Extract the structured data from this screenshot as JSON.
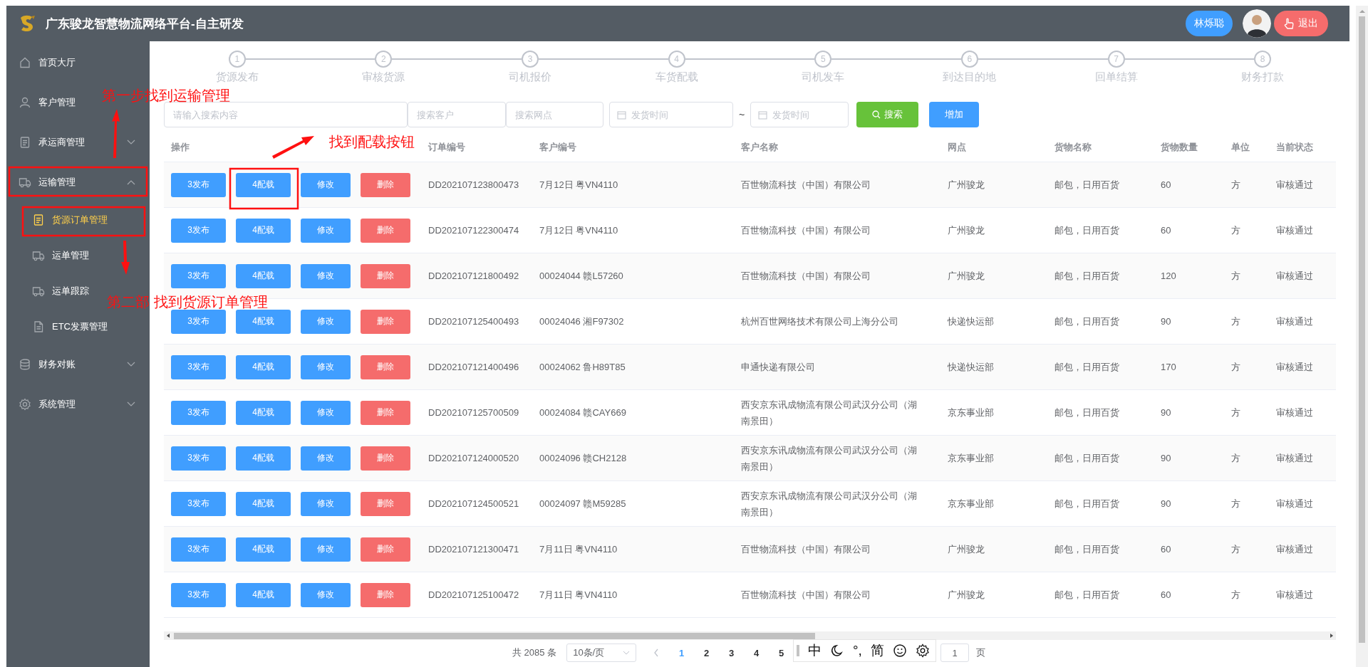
{
  "header": {
    "title": "广东骏龙智慧物流网络平台-自主研发",
    "user_name": "林烁聪",
    "logout": "退出"
  },
  "sidebar": {
    "items": [
      {
        "label": "首页大厅",
        "selected": false
      },
      {
        "label": "客户管理",
        "selected": false
      },
      {
        "label": "承运商管理",
        "selected": false,
        "expanded": false
      },
      {
        "label": "运输管理",
        "selected": false,
        "expanded": true,
        "children": [
          {
            "label": "货源订单管理",
            "selected": true
          },
          {
            "label": "运单管理",
            "selected": false
          },
          {
            "label": "运单跟踪",
            "selected": false
          },
          {
            "label": "ETC发票管理",
            "selected": false
          }
        ]
      },
      {
        "label": "财务对账",
        "selected": false,
        "expanded": false
      },
      {
        "label": "系统管理",
        "selected": false,
        "expanded": false
      }
    ]
  },
  "steps": [
    {
      "number": "1",
      "label": "货源发布"
    },
    {
      "number": "2",
      "label": "审核货源"
    },
    {
      "number": "3",
      "label": "司机报价"
    },
    {
      "number": "4",
      "label": "车货配载"
    },
    {
      "number": "5",
      "label": "司机发车"
    },
    {
      "number": "6",
      "label": "到达目的地"
    },
    {
      "number": "7",
      "label": "回单结算"
    },
    {
      "number": "8",
      "label": "财务打款"
    }
  ],
  "search": {
    "keyword": {
      "placeholder": "请输入搜索内容"
    },
    "customer": {
      "placeholder": "搜索客户"
    },
    "outlet": {
      "placeholder": "搜索网点"
    },
    "date_from": {
      "placeholder": "发货时间"
    },
    "separator": "~",
    "date_to": {
      "placeholder": "发货时间"
    },
    "search_button": "搜索",
    "add_button": "增加"
  },
  "table": {
    "columns": [
      "操作",
      "订单编号",
      "客户编号",
      "客户名称",
      "网点",
      "货物名称",
      "货物数量",
      "单位",
      "当前状态"
    ],
    "rows": [
      {
        "actions": [
          {
            "label": "3发布",
            "kind": "primary"
          },
          {
            "label": "4配载",
            "kind": "primary"
          },
          {
            "label": "修改",
            "kind": "primary"
          },
          {
            "label": "删除",
            "kind": "danger"
          }
        ],
        "order_no": "DD202107123800473",
        "customer_no": "7月12日 粤VN4110",
        "customer_name": "百世物流科技（中国）有限公司",
        "outlet": "广州骏龙",
        "goods": "邮包，日用百货",
        "quantity": "60",
        "unit": "方",
        "status": "审核通过"
      },
      {
        "actions": [
          {
            "label": "3发布",
            "kind": "primary"
          },
          {
            "label": "4配载",
            "kind": "primary"
          },
          {
            "label": "修改",
            "kind": "primary"
          },
          {
            "label": "删除",
            "kind": "danger"
          }
        ],
        "order_no": "DD202107122300474",
        "customer_no": "7月12日 粤VN4110",
        "customer_name": "百世物流科技（中国）有限公司",
        "outlet": "广州骏龙",
        "goods": "邮包，日用百货",
        "quantity": "60",
        "unit": "方",
        "status": "审核通过"
      },
      {
        "actions": [
          {
            "label": "3发布",
            "kind": "primary"
          },
          {
            "label": "4配载",
            "kind": "primary"
          },
          {
            "label": "修改",
            "kind": "primary"
          },
          {
            "label": "删除",
            "kind": "danger"
          }
        ],
        "order_no": "DD202107121800492",
        "customer_no": "00024044 赣L57260",
        "customer_name": "百世物流科技（中国）有限公司",
        "outlet": "广州骏龙",
        "goods": "邮包，日用百货",
        "quantity": "120",
        "unit": "方",
        "status": "审核通过"
      },
      {
        "actions": [
          {
            "label": "3发布",
            "kind": "primary"
          },
          {
            "label": "4配载",
            "kind": "primary"
          },
          {
            "label": "修改",
            "kind": "primary"
          },
          {
            "label": "删除",
            "kind": "danger"
          }
        ],
        "order_no": "DD202107125400493",
        "customer_no": "00024046 湘F97302",
        "customer_name": "杭州百世网络技术有限公司上海分公司",
        "outlet": "快递快运部",
        "goods": "邮包，日用百货",
        "quantity": "90",
        "unit": "方",
        "status": "审核通过"
      },
      {
        "actions": [
          {
            "label": "3发布",
            "kind": "primary"
          },
          {
            "label": "4配载",
            "kind": "primary"
          },
          {
            "label": "修改",
            "kind": "primary"
          },
          {
            "label": "删除",
            "kind": "danger"
          }
        ],
        "order_no": "DD202107121400496",
        "customer_no": "00024062 鲁H89T85",
        "customer_name": "申通快递有限公司",
        "outlet": "快递快运部",
        "goods": "邮包，日用百货",
        "quantity": "170",
        "unit": "方",
        "status": "审核通过"
      },
      {
        "actions": [
          {
            "label": "3发布",
            "kind": "primary"
          },
          {
            "label": "4配载",
            "kind": "primary"
          },
          {
            "label": "修改",
            "kind": "primary"
          },
          {
            "label": "删除",
            "kind": "danger"
          }
        ],
        "order_no": "DD202107125700509",
        "customer_no": "00024084 赣CAY669",
        "customer_name": "西安京东讯成物流有限公司武汉分公司（湖南景田）",
        "outlet": "京东事业部",
        "goods": "邮包，日用百货",
        "quantity": "90",
        "unit": "方",
        "status": "审核通过"
      },
      {
        "actions": [
          {
            "label": "3发布",
            "kind": "primary"
          },
          {
            "label": "4配载",
            "kind": "primary"
          },
          {
            "label": "修改",
            "kind": "primary"
          },
          {
            "label": "删除",
            "kind": "danger"
          }
        ],
        "order_no": "DD202107124000520",
        "customer_no": "00024096 赣CH2128",
        "customer_name": "西安京东讯成物流有限公司武汉分公司（湖南景田）",
        "outlet": "京东事业部",
        "goods": "邮包，日用百货",
        "quantity": "90",
        "unit": "方",
        "status": "审核通过"
      },
      {
        "actions": [
          {
            "label": "3发布",
            "kind": "primary"
          },
          {
            "label": "4配载",
            "kind": "primary"
          },
          {
            "label": "修改",
            "kind": "primary"
          },
          {
            "label": "删除",
            "kind": "danger"
          }
        ],
        "order_no": "DD202107124500521",
        "customer_no": "00024097 赣M59285",
        "customer_name": "西安京东讯成物流有限公司武汉分公司（湖南景田）",
        "outlet": "京东事业部",
        "goods": "邮包，日用百货",
        "quantity": "90",
        "unit": "方",
        "status": "审核通过"
      },
      {
        "actions": [
          {
            "label": "3发布",
            "kind": "primary"
          },
          {
            "label": "4配载",
            "kind": "primary"
          },
          {
            "label": "修改",
            "kind": "primary"
          },
          {
            "label": "删除",
            "kind": "danger"
          }
        ],
        "order_no": "DD202107121300471",
        "customer_no": "7月11日 粤VN4110",
        "customer_name": "百世物流科技（中国）有限公司",
        "outlet": "广州骏龙",
        "goods": "邮包，日用百货",
        "quantity": "60",
        "unit": "方",
        "status": "审核通过"
      },
      {
        "actions": [
          {
            "label": "3发布",
            "kind": "primary"
          },
          {
            "label": "4配载",
            "kind": "primary"
          },
          {
            "label": "修改",
            "kind": "primary"
          },
          {
            "label": "删除",
            "kind": "danger"
          }
        ],
        "order_no": "DD202107125100472",
        "customer_no": "7月11日 粤VN4110",
        "customer_name": "百世物流科技（中国）有限公司",
        "outlet": "广州骏龙",
        "goods": "邮包，日用百货",
        "quantity": "60",
        "unit": "方",
        "status": "审核通过"
      }
    ]
  },
  "pagination": {
    "total": "共 2085 条",
    "page_size": "10条/页",
    "pages": [
      {
        "label": "1",
        "selected": true
      },
      {
        "label": "2",
        "selected": false
      },
      {
        "label": "3",
        "selected": false
      },
      {
        "label": "4",
        "selected": false
      },
      {
        "label": "5",
        "selected": false
      }
    ],
    "goto_value": "1",
    "goto_suffix": "页"
  },
  "ime": {
    "mode": "中",
    "punctuation": "°,",
    "script": "简"
  },
  "annotations": [
    {
      "text": "第一步找到运输管理"
    },
    {
      "text": "找到配载按钮"
    },
    {
      "text": "第二部 找到货源订单管理"
    }
  ]
}
